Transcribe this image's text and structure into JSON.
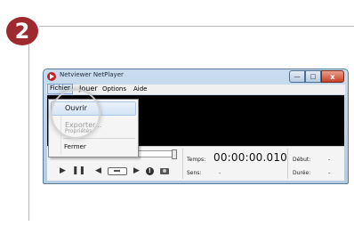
{
  "step": {
    "number": "2",
    "badge_color": "#9e2a2f"
  },
  "window": {
    "title": "Netviewer NetPlayer",
    "buttons": {
      "minimize": "—",
      "maximize": "□",
      "close": "x"
    }
  },
  "menubar": {
    "items": [
      "Fichier",
      "Jouer",
      "Options",
      "Aide"
    ],
    "active": "Fichier"
  },
  "file_menu": {
    "items": [
      {
        "label": "Ouvrir",
        "state": "hover"
      },
      {
        "label": "Exporter...",
        "state": "disabled"
      },
      {
        "label": "Propriétés",
        "state": "disabled"
      },
      {
        "label": "Fermer",
        "state": "normal"
      }
    ]
  },
  "player": {
    "temps_label": "Temps:",
    "temps_value": "00:00:00.010",
    "sens_label": "Sens:",
    "sens_value": "-",
    "debut_label": "Début:",
    "debut_value": "-",
    "duree_label": "Durée:",
    "duree_value": "-",
    "controls": [
      "play-icon",
      "pause-icon",
      "step-back-icon",
      "frame-icon",
      "step-forward-icon",
      "info-icon",
      "camera-icon"
    ]
  }
}
